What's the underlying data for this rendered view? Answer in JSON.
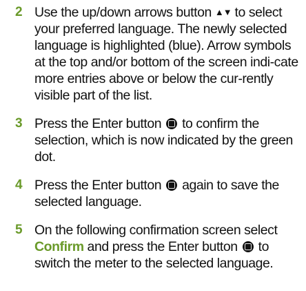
{
  "steps": [
    {
      "number": "2",
      "parts": {
        "a": "Use the up/down arrows button ",
        "arrows": "▲▼",
        "b": " to select your preferred language. The newly selected language is highlighted (blue). Arrow symbols at the top and/or bottom of the screen indi-cate more entries above or below the cur-rently visible part of the list."
      }
    },
    {
      "number": "3",
      "parts": {
        "a": "Press the Enter button ",
        "b": " to confirm the selection, which is now indicated by the green dot."
      }
    },
    {
      "number": "4",
      "parts": {
        "a": "Press the Enter button ",
        "b": " again to save the selected language."
      }
    },
    {
      "number": "5",
      "parts": {
        "a": "On the following confirmation screen select ",
        "keyword": "Confirm",
        "b": " and press the Enter button ",
        "c": " to switch the meter to the selected language."
      }
    }
  ],
  "colors": {
    "accent_green": "#6a9a2a",
    "text": "#111111"
  },
  "icons": {
    "arrows": "up-down-arrows-icon",
    "enter": "enter-button-icon"
  }
}
